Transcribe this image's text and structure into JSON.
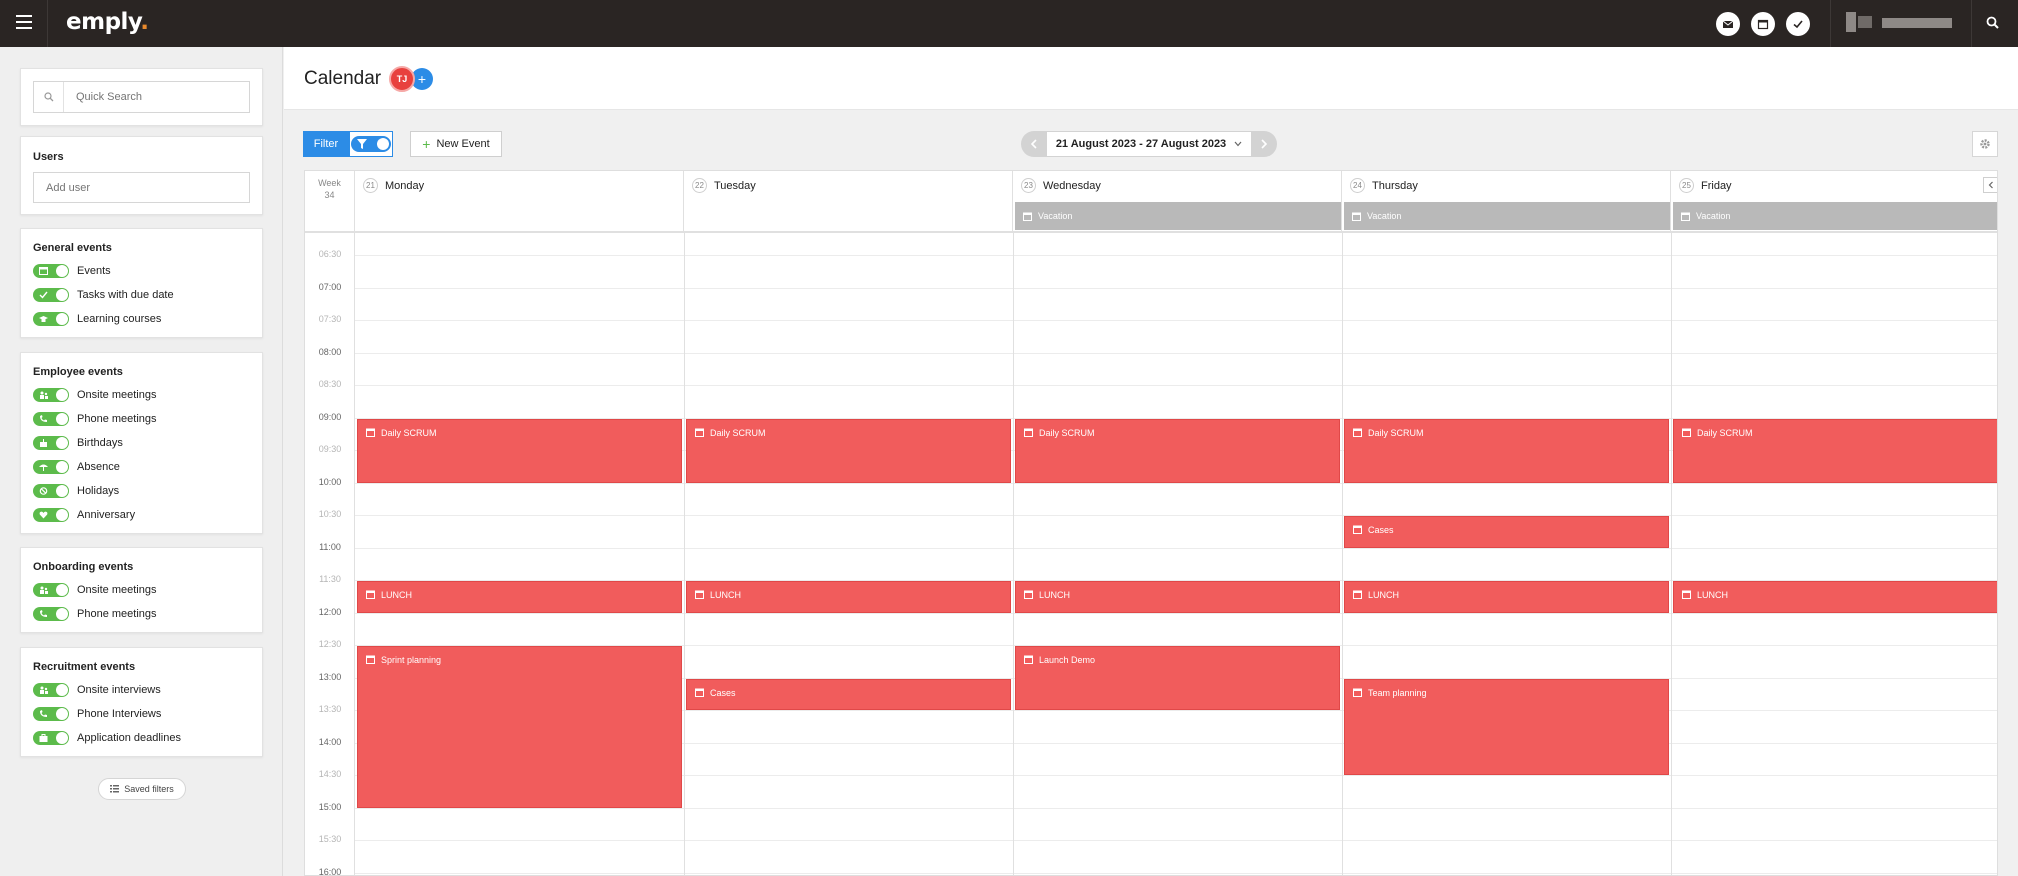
{
  "topbar": {
    "logo": "emply",
    "logo_dot": "."
  },
  "sidebar": {
    "search_placeholder": "Quick Search",
    "users_title": "Users",
    "add_user_placeholder": "Add user",
    "general": {
      "title": "General events",
      "items": [
        "Events",
        "Tasks with due date",
        "Learning courses"
      ]
    },
    "employee": {
      "title": "Employee events",
      "items": [
        "Onsite meetings",
        "Phone meetings",
        "Birthdays",
        "Absence",
        "Holidays",
        "Anniversary"
      ]
    },
    "onboarding": {
      "title": "Onboarding events",
      "items": [
        "Onsite meetings",
        "Phone meetings"
      ]
    },
    "recruitment": {
      "title": "Recruitment events",
      "items": [
        "Onsite interviews",
        "Phone Interviews",
        "Application deadlines"
      ]
    },
    "saved_filters": "Saved filters"
  },
  "main": {
    "title": "Calendar",
    "avatar_initials": "TJ",
    "avatar_add": "+",
    "filter_label": "Filter",
    "new_event_label": "New Event",
    "date_range": "21 August 2023 - 27 August 2023"
  },
  "calendar": {
    "week_label": "Week",
    "week_number": "34",
    "days": [
      {
        "num": "21",
        "name": "Monday"
      },
      {
        "num": "22",
        "name": "Tuesday"
      },
      {
        "num": "23",
        "name": "Wednesday",
        "allday": "Vacation"
      },
      {
        "num": "24",
        "name": "Thursday",
        "allday": "Vacation"
      },
      {
        "num": "25",
        "name": "Friday",
        "allday": "Vacation"
      }
    ],
    "times": [
      "06:30",
      "07:00",
      "07:30",
      "08:00",
      "08:30",
      "09:00",
      "09:30",
      "10:00",
      "10:30",
      "11:00",
      "11:30",
      "12:00",
      "12:30",
      "13:00",
      "13:30",
      "14:00",
      "14:30",
      "15:00",
      "15:30",
      "16:00"
    ],
    "events": [
      {
        "day": 0,
        "title": "Daily SCRUM",
        "start": "09:00",
        "end": "10:00"
      },
      {
        "day": 1,
        "title": "Daily SCRUM",
        "start": "09:00",
        "end": "10:00"
      },
      {
        "day": 2,
        "title": "Daily SCRUM",
        "start": "09:00",
        "end": "10:00"
      },
      {
        "day": 3,
        "title": "Daily SCRUM",
        "start": "09:00",
        "end": "10:00"
      },
      {
        "day": 4,
        "title": "Daily SCRUM",
        "start": "09:00",
        "end": "10:00"
      },
      {
        "day": 3,
        "title": "Cases",
        "start": "10:30",
        "end": "11:00"
      },
      {
        "day": 0,
        "title": "LUNCH",
        "start": "11:30",
        "end": "12:00"
      },
      {
        "day": 1,
        "title": "LUNCH",
        "start": "11:30",
        "end": "12:00"
      },
      {
        "day": 2,
        "title": "LUNCH",
        "start": "11:30",
        "end": "12:00"
      },
      {
        "day": 3,
        "title": "LUNCH",
        "start": "11:30",
        "end": "12:00"
      },
      {
        "day": 4,
        "title": "LUNCH",
        "start": "11:30",
        "end": "12:00"
      },
      {
        "day": 0,
        "title": "Sprint planning",
        "start": "12:30",
        "end": "15:00"
      },
      {
        "day": 1,
        "title": "Cases",
        "start": "13:00",
        "end": "13:30"
      },
      {
        "day": 2,
        "title": "Launch Demo",
        "start": "12:30",
        "end": "13:30"
      },
      {
        "day": 3,
        "title": "Team planning",
        "start": "13:00",
        "end": "14:30"
      }
    ]
  }
}
